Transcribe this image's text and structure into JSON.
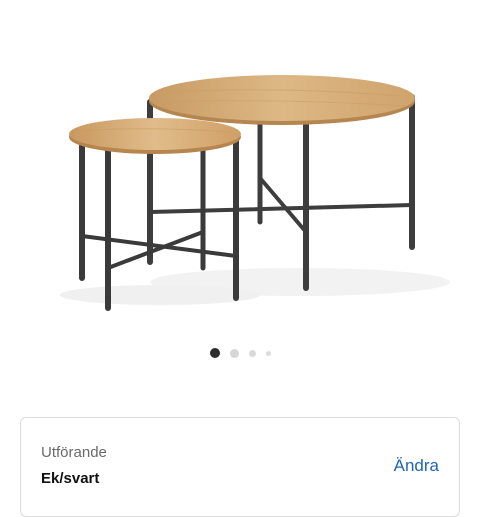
{
  "product": {
    "image_alt": "Product image",
    "variant": {
      "label": "Utförande",
      "value": "Ek/svart",
      "change_label": "Ändra"
    }
  },
  "carousel": {
    "total": 4,
    "active": 0
  },
  "colors": {
    "link": "#1f66b3",
    "wood": "#d8b27a",
    "metal": "#3b3b3b"
  }
}
